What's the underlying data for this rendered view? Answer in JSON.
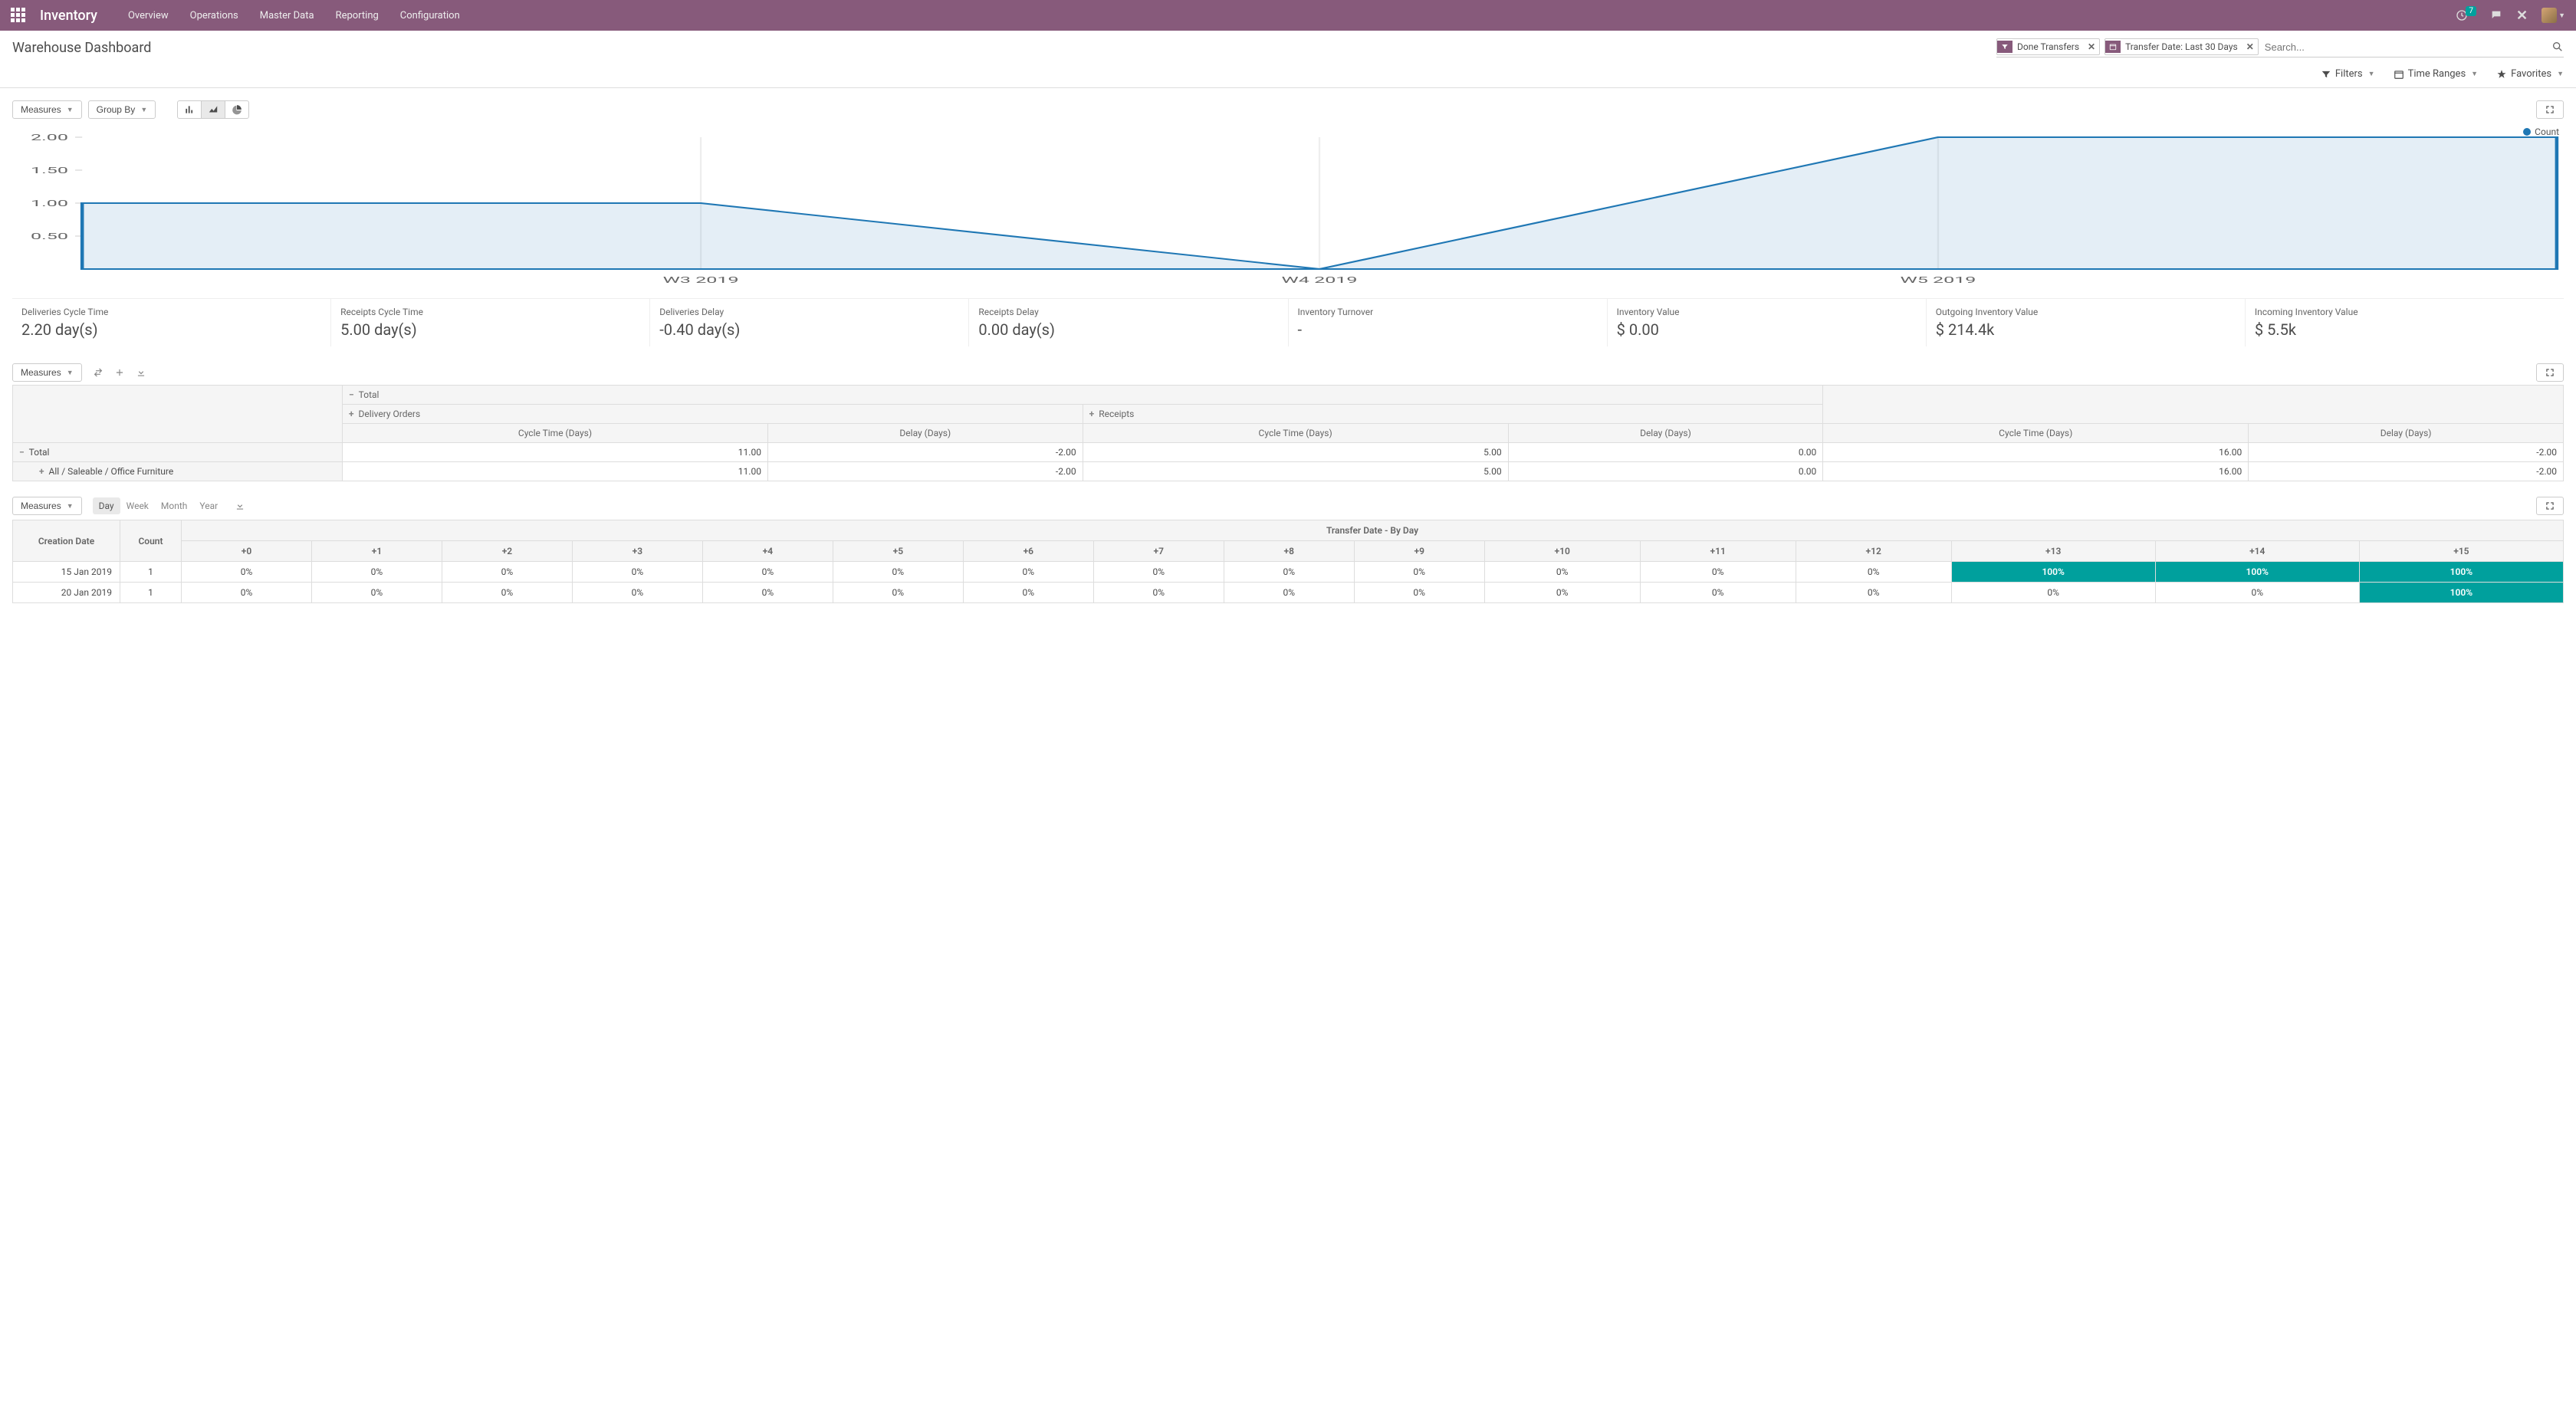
{
  "navbar": {
    "brand": "Inventory",
    "menu": [
      "Overview",
      "Operations",
      "Master Data",
      "Reporting",
      "Configuration"
    ],
    "badge": "7"
  },
  "header": {
    "title": "Warehouse Dashboard",
    "facets": [
      {
        "icon": "filter",
        "label": "Done Transfers"
      },
      {
        "icon": "calendar",
        "label": "Transfer Date: Last 30 Days"
      }
    ],
    "search_placeholder": "Search...",
    "buttons": {
      "filters": "Filters",
      "time_ranges": "Time Ranges",
      "favorites": "Favorites"
    }
  },
  "graph_panel": {
    "measures": "Measures",
    "group_by": "Group By",
    "legend": "Count"
  },
  "chart_data": {
    "type": "area",
    "title": "",
    "xlabel": "",
    "ylabel": "",
    "categories": [
      "W3 2019",
      "W4 2019",
      "W5 2019"
    ],
    "series": [
      {
        "name": "Count",
        "values": [
          1,
          0,
          2
        ]
      }
    ],
    "ylim": [
      0,
      2
    ],
    "yticks": [
      0.5,
      1.0,
      1.5,
      2.0
    ]
  },
  "kpis": [
    {
      "label": "Deliveries Cycle Time",
      "value": "2.20 day(s)"
    },
    {
      "label": "Receipts Cycle Time",
      "value": "5.00 day(s)"
    },
    {
      "label": "Deliveries Delay",
      "value": "-0.40 day(s)"
    },
    {
      "label": "Receipts Delay",
      "value": "0.00 day(s)"
    },
    {
      "label": "Inventory Turnover",
      "value": "-"
    },
    {
      "label": "Inventory Value",
      "value": "$ 0.00"
    },
    {
      "label": "Outgoing Inventory Value",
      "value": "$ 214.4k"
    },
    {
      "label": "Incoming Inventory Value",
      "value": "$ 5.5k"
    }
  ],
  "pivot": {
    "measures": "Measures",
    "top_total": "Total",
    "groups": [
      {
        "name": "Delivery Orders",
        "cols": [
          "Cycle Time (Days)",
          "Delay (Days)"
        ]
      },
      {
        "name": "Receipts",
        "cols": [
          "Cycle Time (Days)",
          "Delay (Days)"
        ]
      }
    ],
    "grand_cols": [
      "Cycle Time (Days)",
      "Delay (Days)"
    ],
    "rows": [
      {
        "label": "Total",
        "sign": "−",
        "indent": 0,
        "values": [
          "11.00",
          "-2.00",
          "5.00",
          "0.00",
          "16.00",
          "-2.00"
        ]
      },
      {
        "label": "All / Saleable / Office Furniture",
        "sign": "+",
        "indent": 1,
        "values": [
          "11.00",
          "-2.00",
          "5.00",
          "0.00",
          "16.00",
          "-2.00"
        ]
      }
    ]
  },
  "cohort": {
    "measures": "Measures",
    "intervals": [
      "Day",
      "Week",
      "Month",
      "Year"
    ],
    "active_interval": "Day",
    "row_header": "Creation Date",
    "count_header": "Count",
    "group_header": "Transfer Date - By Day",
    "offsets": [
      "+0",
      "+1",
      "+2",
      "+3",
      "+4",
      "+5",
      "+6",
      "+7",
      "+8",
      "+9",
      "+10",
      "+11",
      "+12",
      "+13",
      "+14",
      "+15"
    ],
    "rows": [
      {
        "date": "15 Jan 2019",
        "count": "1",
        "cells": [
          "0%",
          "0%",
          "0%",
          "0%",
          "0%",
          "0%",
          "0%",
          "0%",
          "0%",
          "0%",
          "0%",
          "0%",
          "0%",
          "100%",
          "100%",
          "100%"
        ]
      },
      {
        "date": "20 Jan 2019",
        "count": "1",
        "cells": [
          "0%",
          "0%",
          "0%",
          "0%",
          "0%",
          "0%",
          "0%",
          "0%",
          "0%",
          "0%",
          "0%",
          "0%",
          "0%",
          "0%",
          "0%",
          "100%"
        ]
      }
    ]
  }
}
